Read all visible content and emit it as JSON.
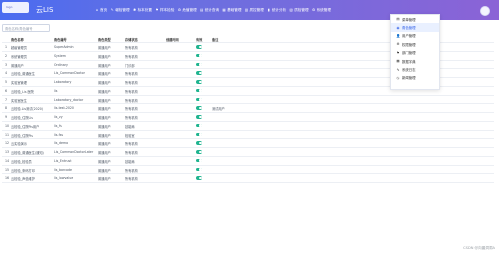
{
  "app": {
    "logo_text": "logo",
    "title": "云LIS"
  },
  "nav": [
    {
      "icon": "home-icon",
      "glyph": "⌂",
      "label": "首页"
    },
    {
      "icon": "edit-icon",
      "glyph": "✎",
      "label": "報检管理"
    },
    {
      "icon": "wrench-icon",
      "glyph": "✱",
      "label": "标本处置"
    },
    {
      "icon": "flag-icon",
      "glyph": "⚑",
      "label": "样本检验"
    },
    {
      "icon": "gear-icon",
      "glyph": "⚙",
      "label": "危值管理"
    },
    {
      "icon": "chart-icon",
      "glyph": "▤",
      "label": "统计查询"
    },
    {
      "icon": "doc-icon",
      "glyph": "▦",
      "label": "基础管理"
    },
    {
      "icon": "grid-icon",
      "glyph": "▥",
      "label": "质控管理"
    },
    {
      "icon": "bar-icon",
      "glyph": "▮",
      "label": "统计分析"
    },
    {
      "icon": "book-icon",
      "glyph": "▧",
      "label": "质检管理"
    },
    {
      "icon": "settings-icon",
      "glyph": "⚙",
      "label": "系统管理"
    }
  ],
  "search": {
    "placeholder": "角色名称/角色编号"
  },
  "table": {
    "headers": {
      "idx": "",
      "name": "角色名称",
      "code": "角色编号",
      "type": "角色类型",
      "state": "存储状态",
      "effect": "创建时间",
      "enable": "有效",
      "note": "备注"
    },
    "rows": [
      {
        "idx": "1",
        "name": "超级管理员",
        "code": "SuperAdmin",
        "type": "普通用户",
        "state": "所有机构",
        "note": ""
      },
      {
        "idx": "2",
        "name": "系统管理员",
        "code": "System",
        "type": "普通用户",
        "state": "所有机构",
        "note": ""
      },
      {
        "idx": "3",
        "name": "普通用户",
        "code": "Ordinary",
        "type": "普通用户",
        "state": "门诊部",
        "note": ""
      },
      {
        "idx": "4",
        "name": "云检验_普通医生",
        "code": "Lis_CommonDoctor",
        "type": "普通用户",
        "state": "所有机构",
        "note": ""
      },
      {
        "idx": "5",
        "name": "实验室管理",
        "code": "Laboratory",
        "type": "普通用户",
        "state": "所有机构",
        "note": ""
      },
      {
        "idx": "6",
        "name": "云检验_Lis 医院",
        "code": "lis",
        "type": "普通用户",
        "state": "所有机构",
        "note": ""
      },
      {
        "idx": "7",
        "name": "实验室医生",
        "code": "Laboratory_doctor",
        "type": "普通用户",
        "state": "所有机构",
        "note": ""
      },
      {
        "idx": "8",
        "name": "云检验-Lis测试(2020)",
        "code": "lis-test-2020",
        "type": "普通用户",
        "state": "所有机构",
        "note": "测试用户"
      },
      {
        "idx": "9",
        "name": "云检验_住院Lis",
        "code": "lis_zy",
        "type": "普通用户",
        "state": "所有机构",
        "note": ""
      },
      {
        "idx": "10",
        "name": "云检验_住院Pis用户",
        "code": "lis_fs",
        "type": "普通用户",
        "state": "技能局",
        "note": ""
      },
      {
        "idx": "11",
        "name": "云检验_住院Pis",
        "code": "lis-fss",
        "type": "普通用户",
        "state": "检验室",
        "note": ""
      },
      {
        "idx": "12",
        "name": "云实验演示",
        "code": "lis_demo",
        "type": "普通用户",
        "state": "所有机构",
        "note": ""
      },
      {
        "idx": "13",
        "name": "云检验_普通医生(通知)",
        "code": "Lis_CommonDoctorLater",
        "type": "普通用户",
        "state": "所有机构",
        "note": ""
      },
      {
        "idx": "14",
        "name": "云检验_检验员",
        "code": "Lis_Entrust",
        "type": "普通用户",
        "state": "技能局",
        "note": ""
      },
      {
        "idx": "15",
        "name": "云检验_条码打印",
        "code": "lis_barcode",
        "type": "普通用户",
        "state": "所有机构",
        "note": ""
      },
      {
        "idx": "16",
        "name": "云检验_声值维护",
        "code": "lis_lowvalue",
        "type": "普通用户",
        "state": "所有机构",
        "note": ""
      }
    ]
  },
  "dropdown": {
    "items": [
      {
        "icon": "list-icon",
        "glyph": "▤",
        "label": "菜单管理",
        "active": false
      },
      {
        "icon": "role-icon",
        "glyph": "◉",
        "label": "角色管理",
        "active": true
      },
      {
        "icon": "user-icon",
        "glyph": "👤",
        "label": "用户管理",
        "active": false
      },
      {
        "icon": "permission-icon",
        "glyph": "⚙",
        "label": "权限管理",
        "active": false
      },
      {
        "icon": "department-icon",
        "glyph": "⚑",
        "label": "部门管理",
        "active": false
      },
      {
        "icon": "dictionary-icon",
        "glyph": "▦",
        "label": "数据字典",
        "active": false
      },
      {
        "icon": "log-icon",
        "glyph": "✎",
        "label": "系统日志",
        "active": false
      },
      {
        "icon": "news-icon",
        "glyph": "◷",
        "label": "新闻管理",
        "active": false
      }
    ]
  },
  "watermark": "CSDN @向晨洞洞A"
}
